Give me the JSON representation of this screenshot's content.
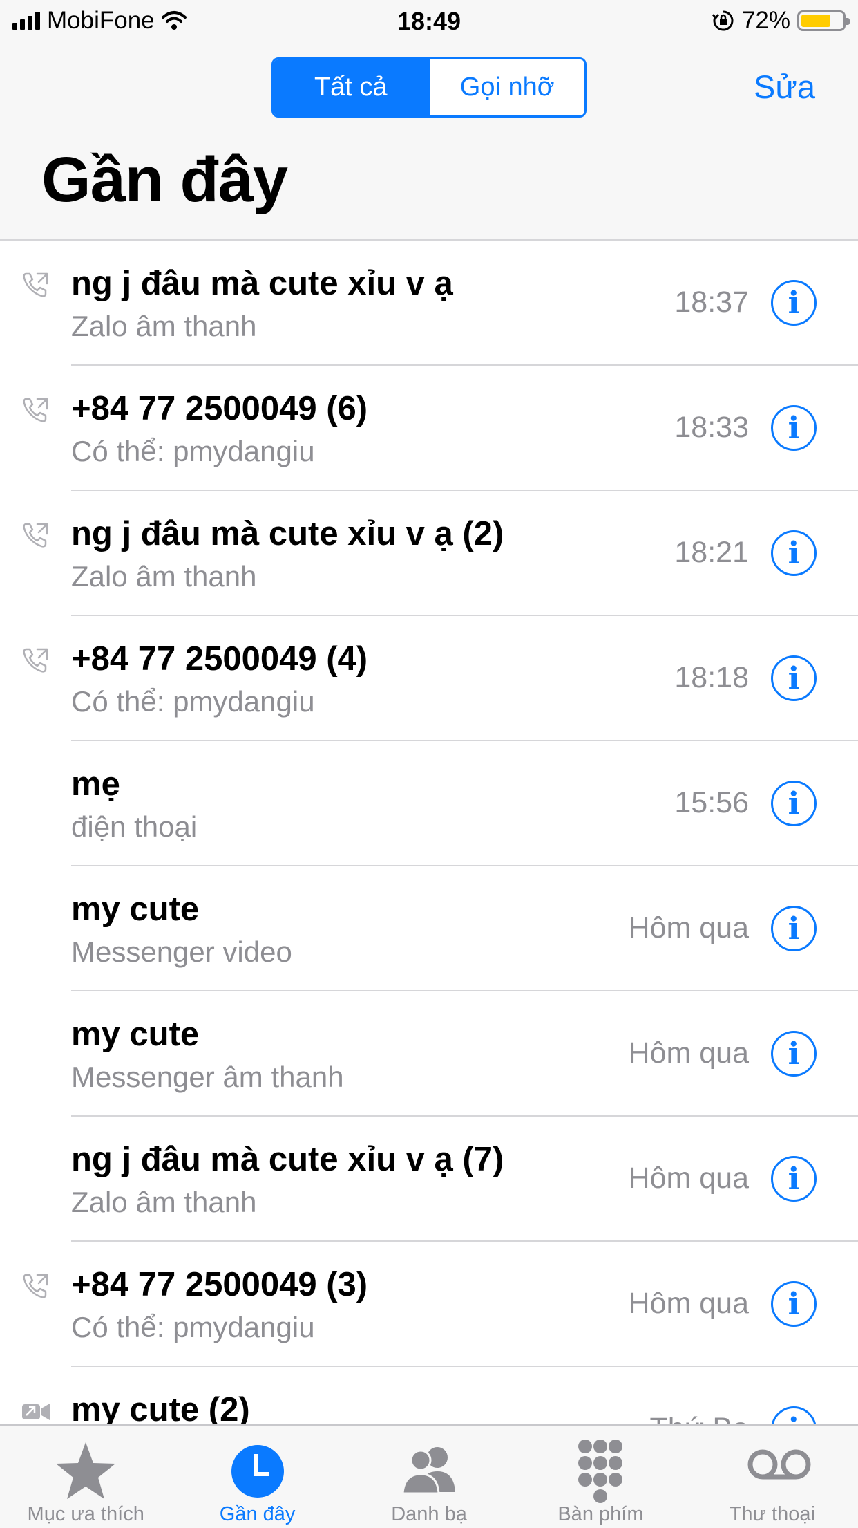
{
  "status_bar": {
    "carrier": "MobiFone",
    "time": "18:49",
    "battery_percent": "72%",
    "battery_level": 0.72
  },
  "header": {
    "segments": [
      {
        "label": "Tất cả",
        "selected": true
      },
      {
        "label": "Gọi nhỡ",
        "selected": false
      }
    ],
    "edit_label": "Sửa",
    "title": "Gần đây"
  },
  "calls": [
    {
      "name": "ng j đâu mà cute xỉu v ạ",
      "subtitle": "Zalo âm thanh",
      "time": "18:37",
      "icon": "outgoing-call-icon"
    },
    {
      "name": "+84 77 2500049 (6)",
      "subtitle": "Có thể: pmydangiu",
      "time": "18:33",
      "icon": "outgoing-call-icon"
    },
    {
      "name": "ng j đâu mà cute xỉu v ạ (2)",
      "subtitle": "Zalo âm thanh",
      "time": "18:21",
      "icon": "outgoing-call-icon"
    },
    {
      "name": "+84 77 2500049 (4)",
      "subtitle": "Có thể: pmydangiu",
      "time": "18:18",
      "icon": "outgoing-call-icon"
    },
    {
      "name": "mẹ",
      "subtitle": "điện thoại",
      "time": "15:56",
      "icon": ""
    },
    {
      "name": "my cute",
      "subtitle": "Messenger video",
      "time": "Hôm qua",
      "icon": ""
    },
    {
      "name": "my cute",
      "subtitle": "Messenger âm thanh",
      "time": "Hôm qua",
      "icon": ""
    },
    {
      "name": "ng j đâu mà cute xỉu v ạ (7)",
      "subtitle": "Zalo âm thanh",
      "time": "Hôm qua",
      "icon": ""
    },
    {
      "name": "+84 77 2500049 (3)",
      "subtitle": "Có thể: pmydangiu",
      "time": "Hôm qua",
      "icon": "outgoing-call-icon"
    },
    {
      "name": "my cute (2)",
      "subtitle": "",
      "time": "Thứ Ba",
      "icon": "outgoing-video-icon"
    }
  ],
  "info_glyph": "i",
  "tabs": [
    {
      "label": "Mục ưa thích",
      "icon": "star-icon",
      "active": false
    },
    {
      "label": "Gần đây",
      "icon": "clock-icon",
      "active": true
    },
    {
      "label": "Danh bạ",
      "icon": "contacts-icon",
      "active": false
    },
    {
      "label": "Bàn phím",
      "icon": "keypad-icon",
      "active": false
    },
    {
      "label": "Thư thoại",
      "icon": "voicemail-icon",
      "active": false
    }
  ],
  "colors": {
    "accent": "#0a7aff",
    "secondary_text": "#8e8e93",
    "battery": "#ffcc00"
  }
}
